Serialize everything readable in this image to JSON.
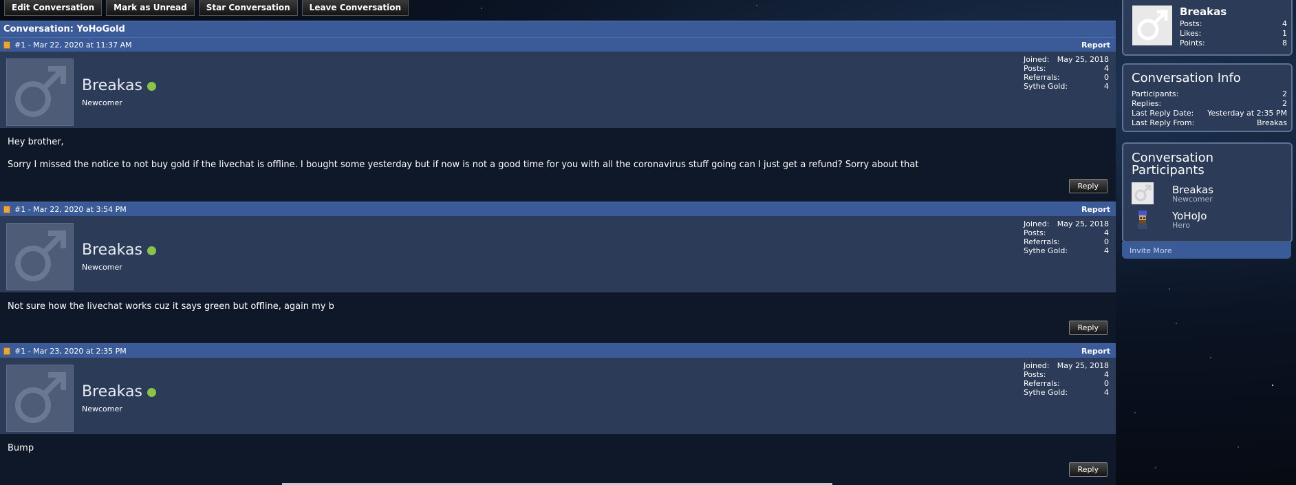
{
  "toolbar": {
    "edit": "Edit Conversation",
    "unread": "Mark as Unread",
    "star": "Star Conversation",
    "leave": "Leave Conversation"
  },
  "conversation": {
    "title": "Conversation: YoHoGold"
  },
  "stat_labels": {
    "joined": "Joined:",
    "posts": "Posts:",
    "referrals": "Referrals:",
    "gold": "Sythe Gold:"
  },
  "labels": {
    "report": "Report",
    "reply": "Reply"
  },
  "messages": [
    {
      "header": "#1 - Mar 22, 2020 at 11:37 AM",
      "user": "Breakas",
      "title": "Newcomer",
      "joined": "May 25, 2018",
      "posts": "4",
      "referrals": "0",
      "gold": "4",
      "body": [
        "Hey brother,",
        "Sorry I missed the notice to not buy gold if the livechat is offline. I bought some yesterday but if now is not a good time for you with all the coronavirus stuff going can I just get a refund? Sorry about that"
      ]
    },
    {
      "header": "#1 - Mar 22, 2020 at 3:54 PM",
      "user": "Breakas",
      "title": "Newcomer",
      "joined": "May 25, 2018",
      "posts": "4",
      "referrals": "0",
      "gold": "4",
      "body": [
        "Not sure how the livechat works cuz it says green but offline, again my b"
      ]
    },
    {
      "header": "#1 - Mar 23, 2020 at 2:35 PM",
      "user": "Breakas",
      "title": "Newcomer",
      "joined": "May 25, 2018",
      "posts": "4",
      "referrals": "0",
      "gold": "4",
      "body": [
        "Bump"
      ]
    }
  ],
  "sidebar": {
    "user": {
      "name": "Breakas",
      "posts_label": "Posts:",
      "posts": "4",
      "likes_label": "Likes:",
      "likes": "1",
      "points_label": "Points:",
      "points": "8"
    },
    "info": {
      "title": "Conversation Info",
      "rows": [
        {
          "label": "Participants:",
          "value": "2"
        },
        {
          "label": "Replies:",
          "value": "2"
        },
        {
          "label": "Last Reply Date:",
          "value": "Yesterday at 2:35 PM"
        },
        {
          "label": "Last Reply From:",
          "value": "Breakas"
        }
      ]
    },
    "participants": {
      "title_line1": "Conversation",
      "title_line2": "Participants",
      "list": [
        {
          "name": "Breakas",
          "title": "Newcomer"
        },
        {
          "name": "YoHoJo",
          "title": "Hero"
        }
      ],
      "invite": "Invite More"
    }
  },
  "colors": {
    "header_blue": "#3a5a98",
    "panel": "#2c3b58",
    "online": "#8bc34a"
  }
}
